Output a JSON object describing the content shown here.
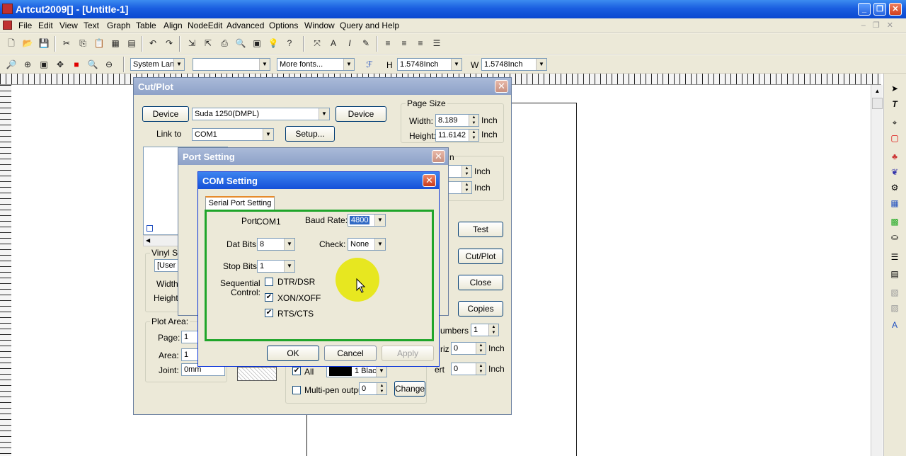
{
  "app": {
    "title": "Artcut2009[] - [Untitle-1]"
  },
  "window_controls": {
    "minimize": "_",
    "restore": "❐",
    "close": "✕"
  },
  "menu": [
    "File",
    "Edit",
    "View",
    "Text",
    "Graph",
    "Table",
    "Align",
    "NodeEdit",
    "Advanced",
    "Options",
    "Window",
    "Query and Help"
  ],
  "toolbar2": {
    "font_script": "System Lan",
    "font_name": "",
    "more_fonts": "More fonts...",
    "h_label": "H",
    "h_value": "1.5748Inch",
    "w_label": "W",
    "w_value": "1.5748Inch"
  },
  "cut_plot": {
    "title": "Cut/Plot",
    "device_btn": "Device",
    "device_value": "Suda 1250(DMPL)",
    "device_btn2": "Device",
    "link_to_label": "Link to",
    "link_to_value": "COM1",
    "setup_btn": "Setup...",
    "page_size_label": "Page Size",
    "width_label": "Width:",
    "width_value": "8.189",
    "width_unit": "Inch",
    "height_label": "Height:",
    "height_value": "11.6142",
    "height_unit": "Inch",
    "partial_n": "n",
    "unit_inch_a": "Inch",
    "unit_inch_b": "Inch",
    "test_btn": "Test",
    "cutplot_btn": "Cut/Plot",
    "close_btn": "Close",
    "copies_btn": "Copies",
    "vinyl_label": "Vinyl Siz",
    "vinyl_value": "[User",
    "vinyl_width": "Width:",
    "vinyl_height": "Height:",
    "plot_area_label": "Plot Area:",
    "page_label": "Page:",
    "page_value": "1",
    "area_label": "Area:",
    "area_value": "1",
    "joint_label": "Joint:",
    "joint_value": "0mm",
    "numbers_label": "umbers",
    "numbers_value": "1",
    "horiz_label": "riz",
    "horiz_value": "0",
    "horiz_unit": "Inch",
    "vert_label": "ert",
    "vert_value": "0",
    "vert_unit": "Inch",
    "all_label": "All",
    "color_value": "1 Blac",
    "multipen_label": "Multi-pen output",
    "multipen_value": "0",
    "change_btn": "Change",
    "partial_t": "T"
  },
  "port_setting": {
    "title": "Port Setting"
  },
  "com_setting": {
    "title": "COM Setting",
    "tab": "Serial Port Setting",
    "port_label": "Port:",
    "port_value": "COM1",
    "baud_label": "Baud Rate:",
    "baud_value": "4800",
    "databits_label": "Dat Bits:",
    "databits_value": "8",
    "check_label": "Check:",
    "check_value": "None",
    "stopbits_label": "Stop Bits:",
    "stopbits_value": "1",
    "seq_label_1": "Sequential",
    "seq_label_2": "Control:",
    "dtr_label": "DTR/DSR",
    "xon_label": "XON/XOFF",
    "rts_label": "RTS/CTS",
    "ok_btn": "OK",
    "cancel_btn": "Cancel",
    "apply_btn": "Apply"
  },
  "colors": {
    "title_active": "#1a5ee0",
    "highlight_group": "#1fa52a",
    "cursor_highlight": "#e6e600"
  }
}
